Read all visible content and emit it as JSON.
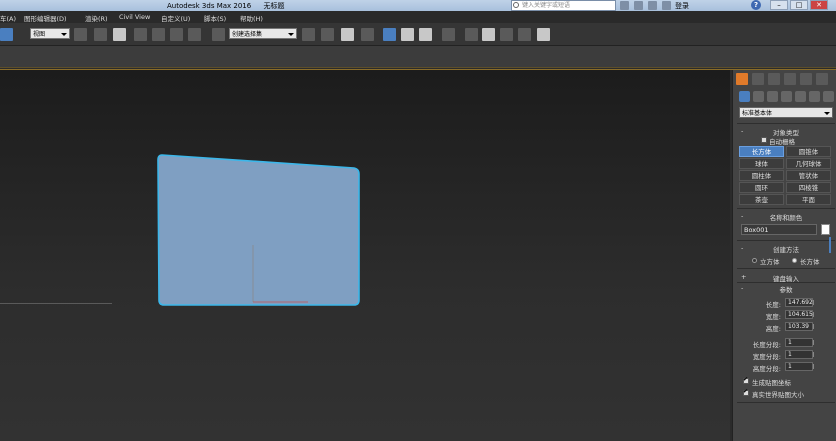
{
  "window": {
    "app_title": "Autodesk 3ds Max 2016",
    "doc_title": "无标题",
    "search_placeholder": "键入关键字或短语",
    "login_label": "登录",
    "help_label": "?",
    "minimize_label": "–",
    "maximize_label": "□",
    "close_label": "✕"
  },
  "menu": {
    "items": [
      "车(A)",
      "图形编辑器(D)",
      "渲染(R)",
      "Civil View",
      "自定义(U)",
      "脚本(S)",
      "帮助(H)"
    ]
  },
  "toolbar": {
    "view_dropdown": "视图",
    "selection_set_dropdown": "创建选择集"
  },
  "panel": {
    "category_select": "标准基本体",
    "object_type": {
      "header": "对象类型",
      "autogrid_label": "自动栅格",
      "autogrid_checked": false,
      "buttons": [
        "长方体",
        "圆锥体",
        "球体",
        "几何球体",
        "圆柱体",
        "管状体",
        "圆环",
        "四棱锥",
        "茶壶",
        "平面"
      ],
      "active_index": 0
    },
    "name_color": {
      "header": "名称和颜色",
      "name_value": "Box001",
      "color": "#ffffff"
    },
    "creation_method": {
      "header": "创建方法",
      "option_cube": "立方体",
      "option_box": "长方体",
      "selected": "长方体"
    },
    "keyboard_entry": {
      "header": "键盘输入",
      "toggle": "+"
    },
    "parameters": {
      "header": "参数",
      "toggle": "-",
      "length_label": "长度:",
      "length_value": "147.692",
      "width_label": "宽度:",
      "width_value": "104.615",
      "height_label": "高度:",
      "height_value": "103.39",
      "length_segs_label": "长度分段:",
      "length_segs_value": "1",
      "width_segs_label": "宽度分段:",
      "width_segs_value": "1",
      "height_segs_label": "高度分段:",
      "height_segs_value": "1",
      "gen_mapping_label": "生成贴图坐标",
      "gen_mapping_checked": true,
      "real_world_label": "真实世界贴图大小",
      "real_world_checked": true
    }
  },
  "colors": {
    "accent": "#4a7fc0",
    "box_fill": "#7f9fc2",
    "box_edge": "#3cb7ea",
    "create_tab": "#e07a2a"
  }
}
